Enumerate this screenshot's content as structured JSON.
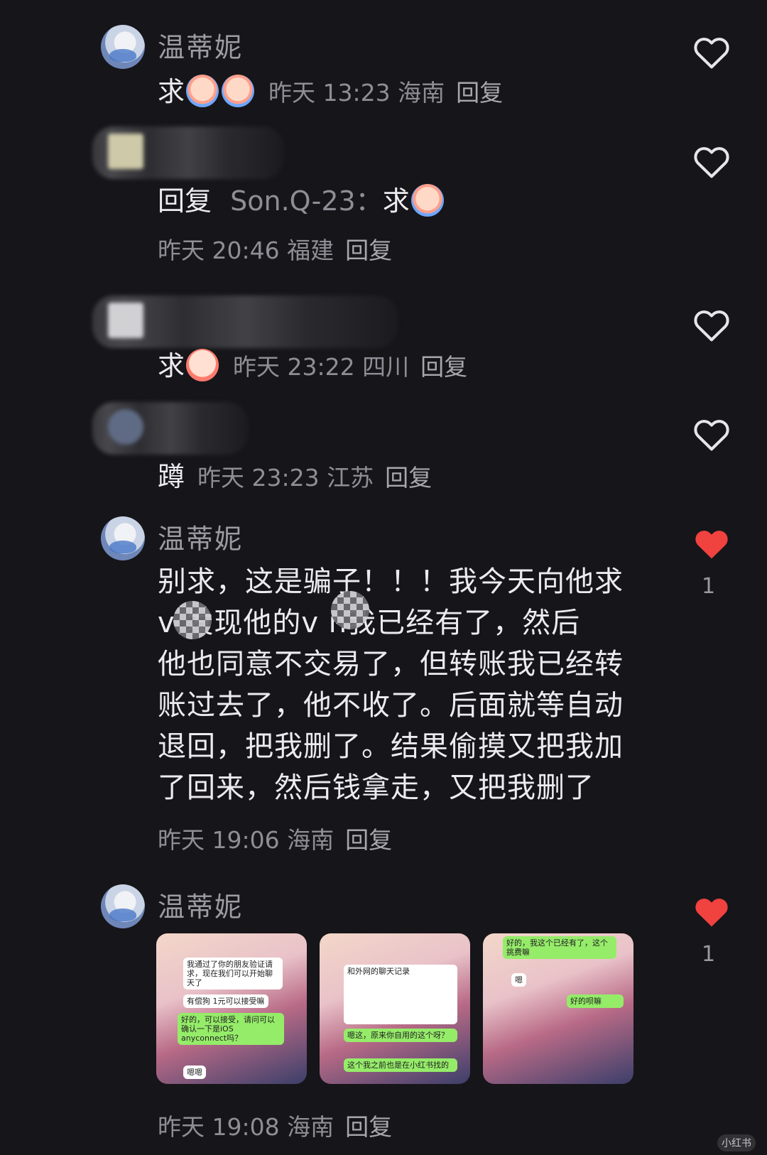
{
  "comments": [
    {
      "username": "温蒂妮",
      "text": "求",
      "time": "昨天 13:23",
      "location": "海南",
      "reply": "回复"
    },
    {
      "reply_prefix": "回复",
      "reply_to": "Son.Q-23：",
      "text": "求",
      "time": "昨天 20:46",
      "location": "福建",
      "reply": "回复"
    },
    {
      "text": "求",
      "time": "昨天 23:22",
      "location": "四川",
      "reply": "回复"
    },
    {
      "text": "蹲",
      "time": "昨天 23:23",
      "location": "江苏",
      "reply": "回复"
    },
    {
      "username": "温蒂妮",
      "lines": [
        "别求，这是骗子！！！我今天向他求",
        "v  发现他的v n我已经有了，然后",
        "他也同意不交易了，但转账我已经转",
        "账过去了，他不收了。后面就等自动",
        "退回，把我删了。结果偷摸又把我加",
        "了回来，然后钱拿走，又把我删了"
      ],
      "time": "昨天 19:06",
      "location": "海南",
      "reply": "回复",
      "likes": "1"
    },
    {
      "username": "温蒂妮",
      "time": "昨天 19:08",
      "location": "海南",
      "reply": "回复",
      "likes": "1"
    }
  ],
  "thumbnails": [
    {
      "bubbles": [
        "我通过了你的朋友验证请求，现在我们可以开始聊天了",
        "有偿狗 1元可以接受嘛",
        "好的，可以接受，请问可以确认一下是iOS anyconnect吗？",
        "嗯嗯"
      ]
    },
    {
      "bubbles": [
        "和外网的聊天记录",
        "嗯这，原来你自用的这个呀？",
        "这个我之前也是在小红书找的"
      ]
    },
    {
      "bubbles": [
        "好的，我这个已经有了，这个挑费嘛",
        "嗯",
        "好的呗嘛"
      ]
    }
  ],
  "watermark": "小红书",
  "colors": {
    "background": "#161519",
    "liked_heart": "#f0423f",
    "icons": [
      "heart-outline-icon",
      "heart-filled-icon"
    ]
  }
}
